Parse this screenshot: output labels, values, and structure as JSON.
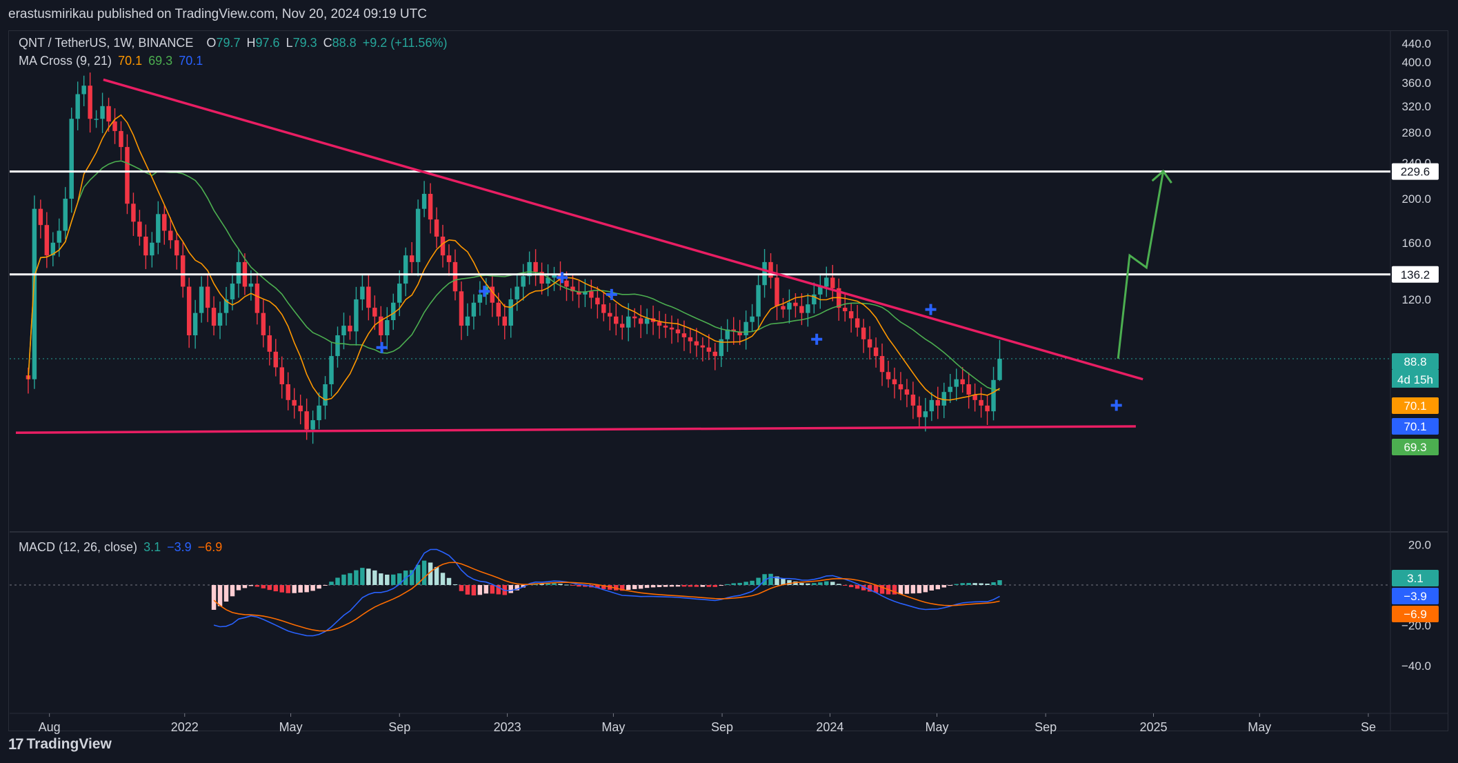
{
  "header": {
    "publisher": "erastusmirikau published on TradingView.com, Nov 20, 2024 09:19 UTC"
  },
  "legend": {
    "symbol": "QNT / TetherUS, 1W, BINANCE",
    "o_label": "O",
    "o_value": "79.7",
    "h_label": "H",
    "h_value": "97.6",
    "l_label": "L",
    "l_value": "79.3",
    "c_label": "C",
    "c_value": "88.8",
    "change": "+9.2 (+11.56%)",
    "ma_title": "MA Cross (9, 21)",
    "ma_fast": "70.1",
    "ma_slow": "69.3",
    "ma_cross": "70.1",
    "macd_title": "MACD (12, 26, close)",
    "macd_hist": "3.1",
    "macd_line": "−3.9",
    "macd_signal": "−6.9"
  },
  "footer": {
    "brand": "TradingView"
  },
  "colors": {
    "background": "#131722",
    "up": "#26a69a",
    "down": "#f23645",
    "ma_fast": "#ff9800",
    "ma_slow": "#4caf50",
    "cross": "#2962ff",
    "trendline": "#e91e63",
    "projection": "#4caf50",
    "level": "#ffffff",
    "macd": "#2962ff",
    "signal": "#ff6d00"
  },
  "chart_data": {
    "type": "candlestick",
    "title": "QNT / TetherUS, 1W, BINANCE",
    "x_tick_labels": [
      "Aug",
      "2022",
      "May",
      "Sep",
      "2023",
      "May",
      "Sep",
      "2024",
      "May",
      "Sep",
      "2025",
      "May",
      "Se"
    ],
    "x_tick_dates": [
      "2021-08-01",
      "2022-01-01",
      "2022-05-01",
      "2022-09-01",
      "2023-01-01",
      "2023-05-01",
      "2023-09-01",
      "2024-01-01",
      "2024-05-01",
      "2024-09-01",
      "2025-01-01",
      "2025-05-01",
      "2025-09-01"
    ],
    "x_range": [
      "2021-06-17",
      "2025-09-26"
    ],
    "price_axis_ticks": [
      "440.0",
      "400.0",
      "360.0",
      "320.0",
      "280.0",
      "240.0",
      "200.0",
      "160.0",
      "120.0"
    ],
    "price_axis_values": [
      440,
      400,
      360,
      320,
      280,
      240,
      200,
      160,
      120
    ],
    "price_range": [
      37,
      470
    ],
    "macd_axis_ticks": [
      "20.0",
      "−20.0",
      "−40.0"
    ],
    "macd_axis_values": [
      20,
      -20,
      -40
    ],
    "macd_range": [
      -52,
      26
    ],
    "last_price_box": "88.8",
    "countdown": "4d 15h",
    "ma_boxes": [
      "70.1",
      "70.1",
      "69.3"
    ],
    "macd_boxes": [
      "3.1",
      "−3.9",
      "−6.9"
    ],
    "horizontal_levels": [
      {
        "value": 229.6,
        "label": "229.6"
      },
      {
        "value": 136.2,
        "label": "136.2"
      }
    ],
    "trendlines": [
      {
        "name": "descending resistance",
        "points": [
          [
            "2021-10-01",
            366
          ],
          [
            "2024-12-20",
            80
          ]
        ]
      },
      {
        "name": "support",
        "points": [
          [
            "2021-06-24",
            61
          ],
          [
            "2024-12-12",
            63
          ]
        ]
      }
    ],
    "projection_path": [
      [
        "2024-11-22",
        88.8
      ],
      [
        "2024-12-05",
        150
      ],
      [
        "2024-12-24",
        141
      ],
      [
        "2025-01-12",
        230
      ]
    ],
    "ma_cross_markers": [
      {
        "date": "2022-08-12",
        "value": 94
      },
      {
        "date": "2022-12-06",
        "value": 125
      },
      {
        "date": "2023-03-04",
        "value": 134
      },
      {
        "date": "2023-04-29",
        "value": 123
      },
      {
        "date": "2023-12-17",
        "value": 98
      },
      {
        "date": "2024-04-24",
        "value": 114
      },
      {
        "date": "2024-11-20",
        "value": 70.1
      }
    ],
    "close_series_weekly": [
      {
        "start": "2021-07-08",
        "closes": [
          80,
          190,
          175,
          150,
          160,
          170,
          200,
          300,
          340,
          355,
          300,
          300,
          320,
          296,
          282,
          260,
          195,
          178,
          165,
          150,
          160,
          185,
          170,
          162,
          150,
          128,
          100,
          112,
          128,
          115,
          105,
          112,
          120,
          130,
          145,
          128,
          130,
          112,
          100,
          92,
          85,
          78,
          72,
          70,
          68,
          62,
          65,
          70,
          78,
          90,
          100,
          105,
          102,
          120,
          128,
          115,
          110,
          100,
          108,
          118,
          130,
          150,
          145,
          190,
          205,
          180,
          165,
          150,
          145,
          125,
          105,
          110,
          118,
          123,
          128,
          118,
          110,
          105,
          120,
          128,
          135,
          145,
          138,
          130,
          134,
          136,
          132,
          128,
          125,
          123,
          125,
          121,
          117,
          112,
          110,
          106,
          104,
          110,
          109,
          106,
          109,
          107,
          105,
          104,
          103,
          101,
          99,
          97,
          95,
          94,
          92,
          90,
          98,
          103,
          102,
          100,
          107,
          110,
          129,
          145,
          134,
          116,
          114,
          118,
          116,
          112,
          117,
          123,
          128,
          134,
          127,
          115,
          113,
          109,
          104,
          98,
          94,
          90,
          83,
          80,
          78,
          76,
          74,
          70,
          66,
          68,
          72,
          70,
          75,
          77,
          80,
          78,
          74,
          72,
          70,
          68,
          79.7,
          88.8
        ]
      }
    ],
    "last_candle": {
      "open": 79.7,
      "high": 97.6,
      "low": 79.3,
      "close": 88.8,
      "change": 9.2,
      "change_pct": 11.56
    },
    "series": [
      {
        "name": "MA Cross (9, 21) fast",
        "last": 70.1
      },
      {
        "name": "MA Cross (9, 21) slow",
        "last": 69.3
      },
      {
        "name": "MACD (12, 26, close)",
        "hist_last": 3.1,
        "macd_last": -3.9,
        "signal_last": -6.9
      }
    ]
  }
}
